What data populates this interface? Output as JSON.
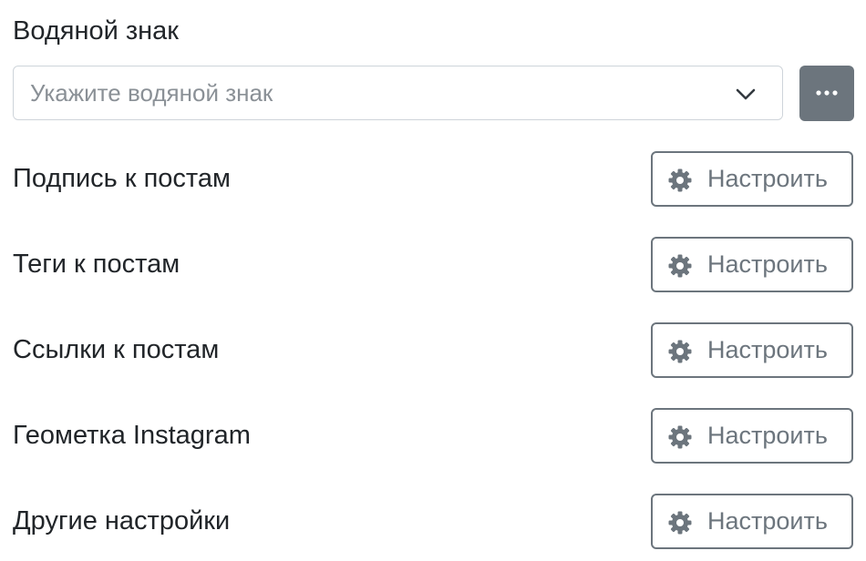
{
  "watermark": {
    "label": "Водяной знак",
    "placeholder": "Укажите водяной знак",
    "more_icon": "more-horizontal-icon",
    "chevron_icon": "chevron-down-icon"
  },
  "settings": [
    {
      "label": "Подпись к постам",
      "button_label": "Настроить",
      "icon": "gear-icon"
    },
    {
      "label": "Теги к постам",
      "button_label": "Настроить",
      "icon": "gear-icon"
    },
    {
      "label": "Ссылки к постам",
      "button_label": "Настроить",
      "icon": "gear-icon"
    },
    {
      "label": "Геометка Instagram",
      "button_label": "Настроить",
      "icon": "gear-icon"
    },
    {
      "label": "Другие настройки",
      "button_label": "Настроить",
      "icon": "gear-icon"
    }
  ],
  "colors": {
    "text": "#212529",
    "muted": "#6c757d",
    "placeholder": "#8a9096",
    "border": "#ced4da",
    "secondary_button": "#6c757d"
  }
}
